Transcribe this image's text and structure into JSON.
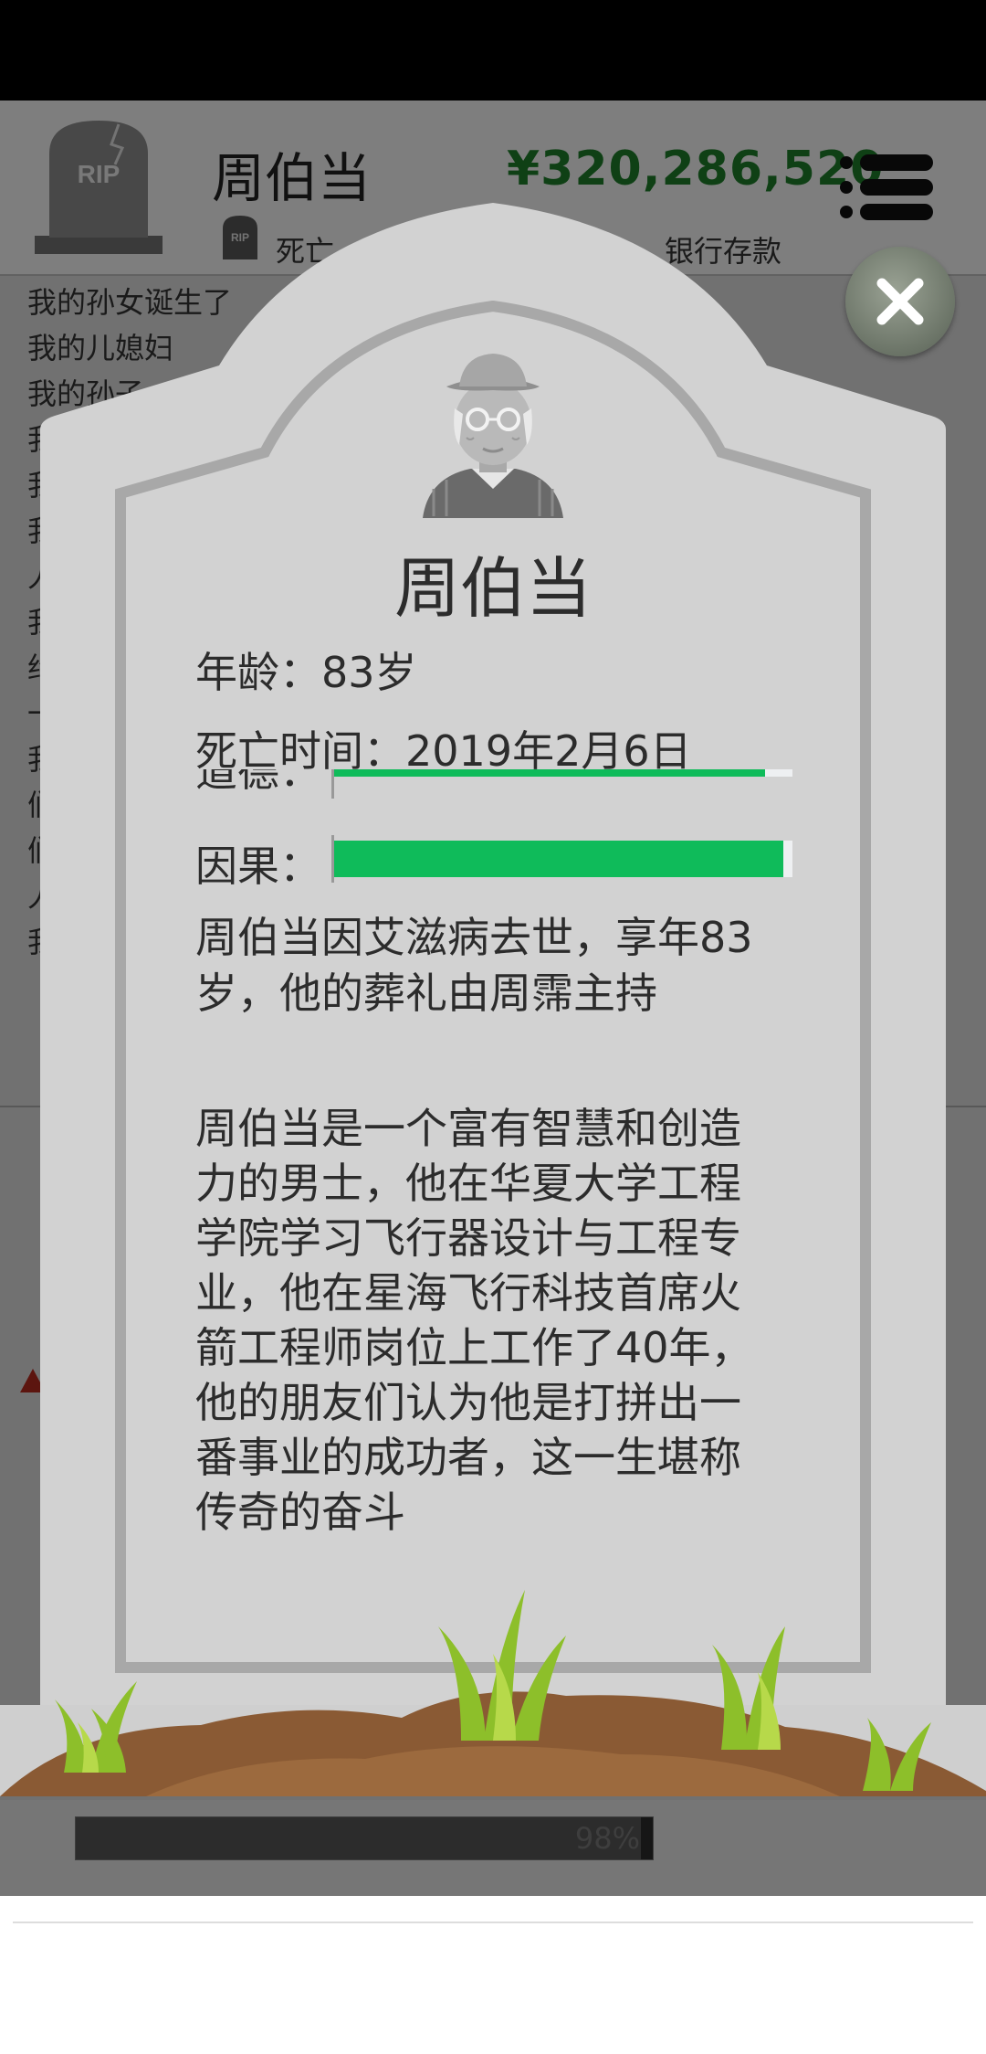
{
  "background": {
    "name": "周伯当",
    "money": "¥320,286,520",
    "rip_text": "RIP",
    "status_text": "死亡",
    "bank_label": "银行存款",
    "log_lines": [
      "我的孙女诞生了",
      "我的儿媳妇",
      "我的孙子",
      "我",
      "我",
      "我",
      "人",
      "我",
      "约",
      "一",
      "我",
      "们",
      "们",
      "",
      "人",
      "我"
    ],
    "stat_label": "道德",
    "stat_value": 98,
    "stat_percent": "98%"
  },
  "tombstone": {
    "name": "周伯当",
    "age_label": "年龄：",
    "age_value": "83岁",
    "death_label": "死亡时间：",
    "death_value": "2019年2月6日",
    "partial_label": "道德：",
    "partial_value": 94,
    "karma_label": "因果：",
    "karma_value": 98,
    "death_note": "周伯当因艾滋病去世，享年83岁，他的葬礼由周霈主持",
    "biography": "周伯当是一个富有智慧和创造力的男士，他在华夏大学工程学院学习飞行器设计与工程专业，他在星海飞行科技首席火箭工程师岗位上工作了40年，他的朋友们认为他是打拼出一番事业的成功者，这一生堪称传奇的奋斗"
  },
  "colors": {
    "money": "#1e7b2a",
    "bar_fill": "#0fbb5a",
    "tomb_stone": "#d2d2d2",
    "soil": "#8a5a34",
    "grass": "#8dbf2a"
  },
  "icons": {
    "close": "close-icon",
    "menu": "menu-icon",
    "tombstone": "rip-tombstone-icon",
    "avatar": "old-man-avatar-icon"
  }
}
